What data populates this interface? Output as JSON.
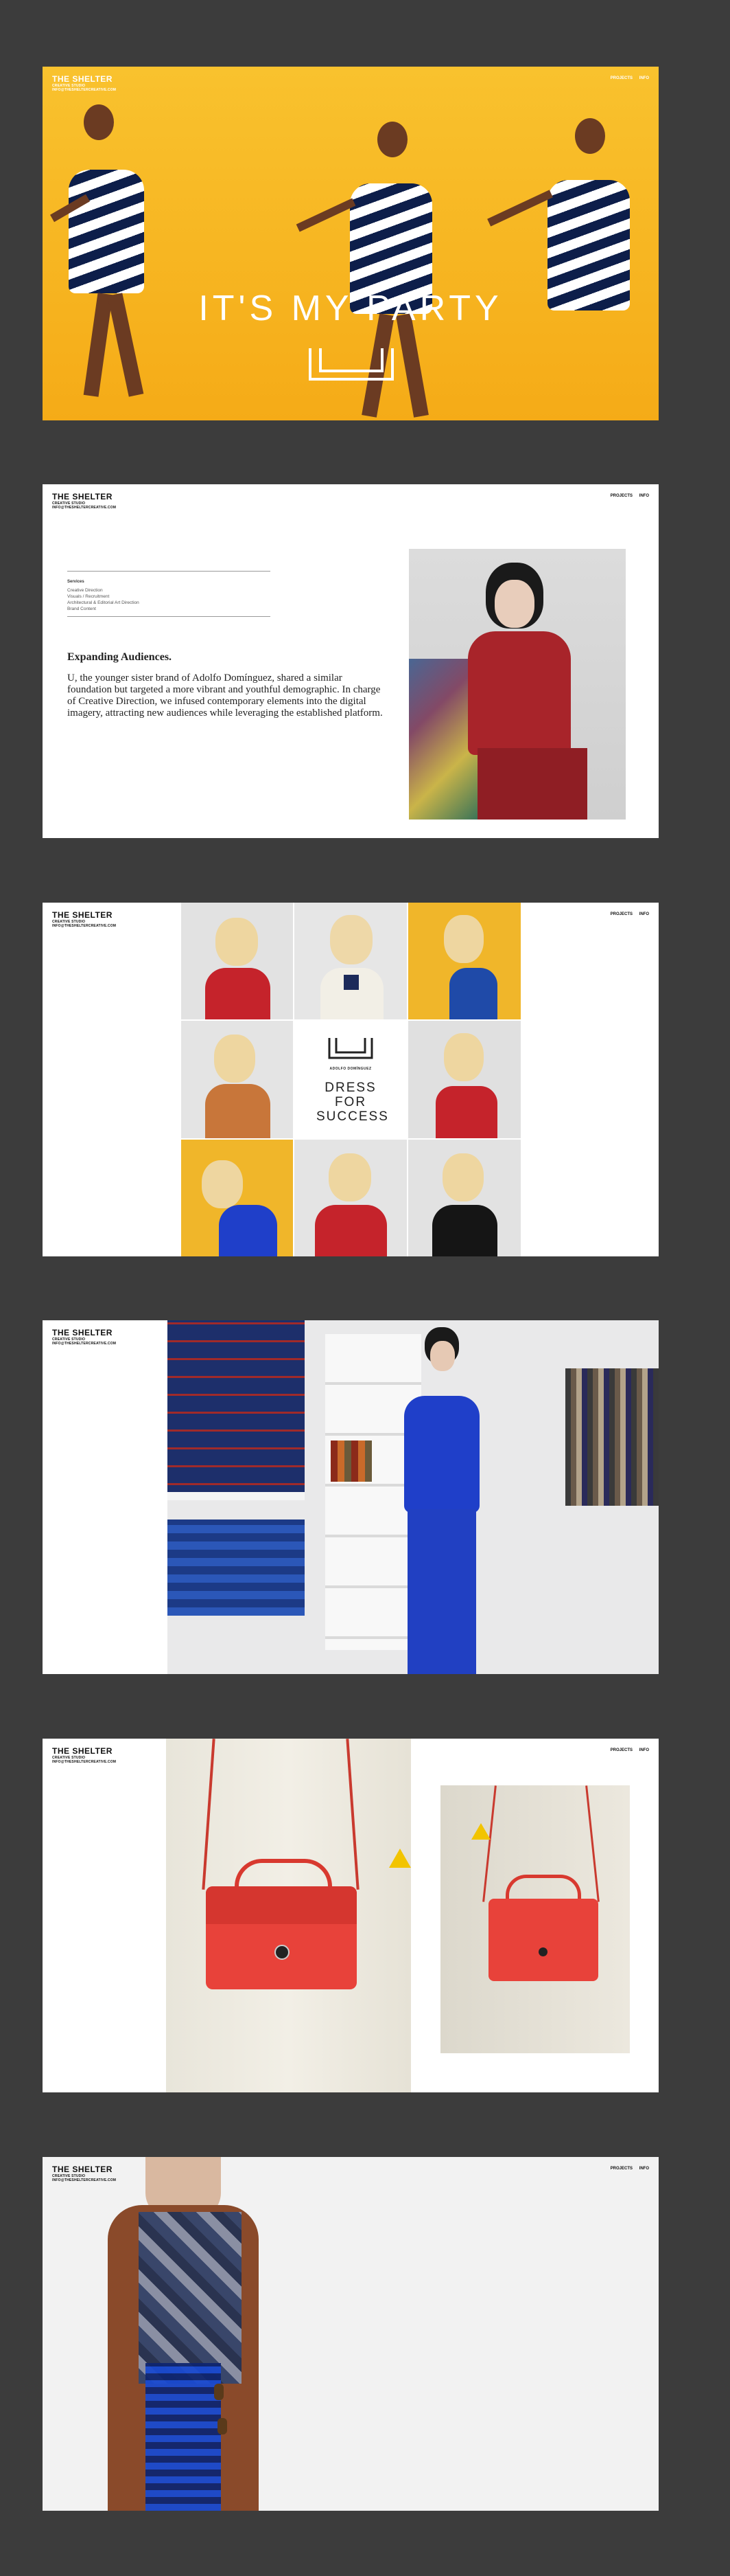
{
  "brand": {
    "name": "THE SHELTER",
    "tagline_line1": "CREATIVE STUDIO",
    "tagline_line2": "INFO@THESHELTERCREATIVE.COM"
  },
  "nav": {
    "projects": "PROJECTS",
    "info": "INFO"
  },
  "slide1": {
    "headline": "IT'S MY PARTY"
  },
  "slide2": {
    "services_title": "Services",
    "services": [
      "Creative Direction",
      "Visuals / Recruitment",
      "Architectural & Editorial Art Direction",
      "Brand Content"
    ],
    "heading": "Expanding Audiences.",
    "body": "U, the younger sister brand of Adolfo Domínguez, shared a similar foundation but targeted a more vibrant and youthful demographic. In charge of Creative Direction, we infused contemporary elements into the digital imagery, attracting new audiences while leveraging the established platform."
  },
  "slide3": {
    "logo_caption": "ADOLFO DOMÍNGUEZ",
    "tile_text": "DRESS FOR SUCCESS"
  },
  "colors": {
    "background": "#3c3c3c",
    "yellow": "#f7b61d",
    "red": "#c0242c",
    "blue": "#1f3fc9",
    "bag_red": "#e8423a"
  }
}
